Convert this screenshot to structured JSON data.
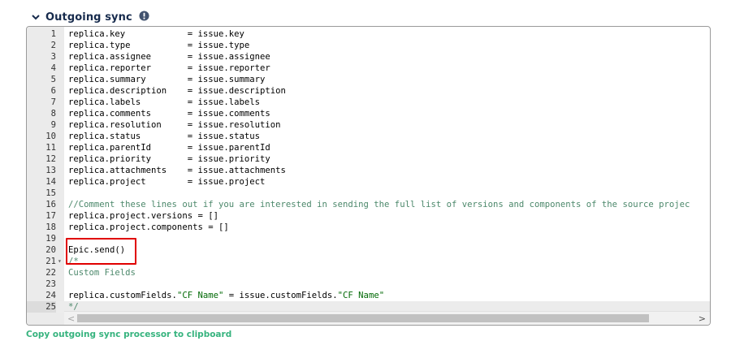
{
  "section": {
    "title": "Outgoing sync",
    "chevron_icon": "chevron-down-icon",
    "info_icon": "info-circle-icon"
  },
  "editor": {
    "active_line": 25,
    "highlighted_line": 20,
    "lines": [
      {
        "n": "1",
        "code": "replica.key            = issue.key"
      },
      {
        "n": "2",
        "code": "replica.type           = issue.type"
      },
      {
        "n": "3",
        "code": "replica.assignee       = issue.assignee"
      },
      {
        "n": "4",
        "code": "replica.reporter       = issue.reporter"
      },
      {
        "n": "5",
        "code": "replica.summary        = issue.summary"
      },
      {
        "n": "6",
        "code": "replica.description    = issue.description"
      },
      {
        "n": "7",
        "code": "replica.labels         = issue.labels"
      },
      {
        "n": "8",
        "code": "replica.comments       = issue.comments"
      },
      {
        "n": "9",
        "code": "replica.resolution     = issue.resolution"
      },
      {
        "n": "10",
        "code": "replica.status         = issue.status"
      },
      {
        "n": "11",
        "code": "replica.parentId       = issue.parentId"
      },
      {
        "n": "12",
        "code": "replica.priority       = issue.priority"
      },
      {
        "n": "13",
        "code": "replica.attachments    = issue.attachments"
      },
      {
        "n": "14",
        "code": "replica.project        = issue.project"
      },
      {
        "n": "15",
        "code": ""
      },
      {
        "n": "16",
        "code": "//Comment these lines out if you are interested in sending the full list of versions and components of the source projec",
        "type": "comment"
      },
      {
        "n": "17",
        "code": "replica.project.versions = []"
      },
      {
        "n": "18",
        "code": "replica.project.components = []"
      },
      {
        "n": "19",
        "code": ""
      },
      {
        "n": "20",
        "code": "Epic.send()"
      },
      {
        "n": "21",
        "code": "/*",
        "type": "comment",
        "fold": true
      },
      {
        "n": "22",
        "code": "Custom Fields",
        "type": "comment"
      },
      {
        "n": "23",
        "code": ""
      },
      {
        "n": "24",
        "code": "replica.customFields.\"CF Name\" = issue.customFields.\"CF Name\"",
        "type": "strline"
      },
      {
        "n": "25",
        "code": "*/",
        "type": "comment"
      }
    ]
  },
  "scrollbar": {
    "left_arrow": "<",
    "right_arrow": ">"
  },
  "copy_link": "Copy outgoing sync processor to clipboard",
  "colors": {
    "title": "#172b4d",
    "link": "#36b37e",
    "comment": "#4c886b",
    "string": "#036a07",
    "highlight_box": "#e00000",
    "gutter": "#ebebeb"
  }
}
